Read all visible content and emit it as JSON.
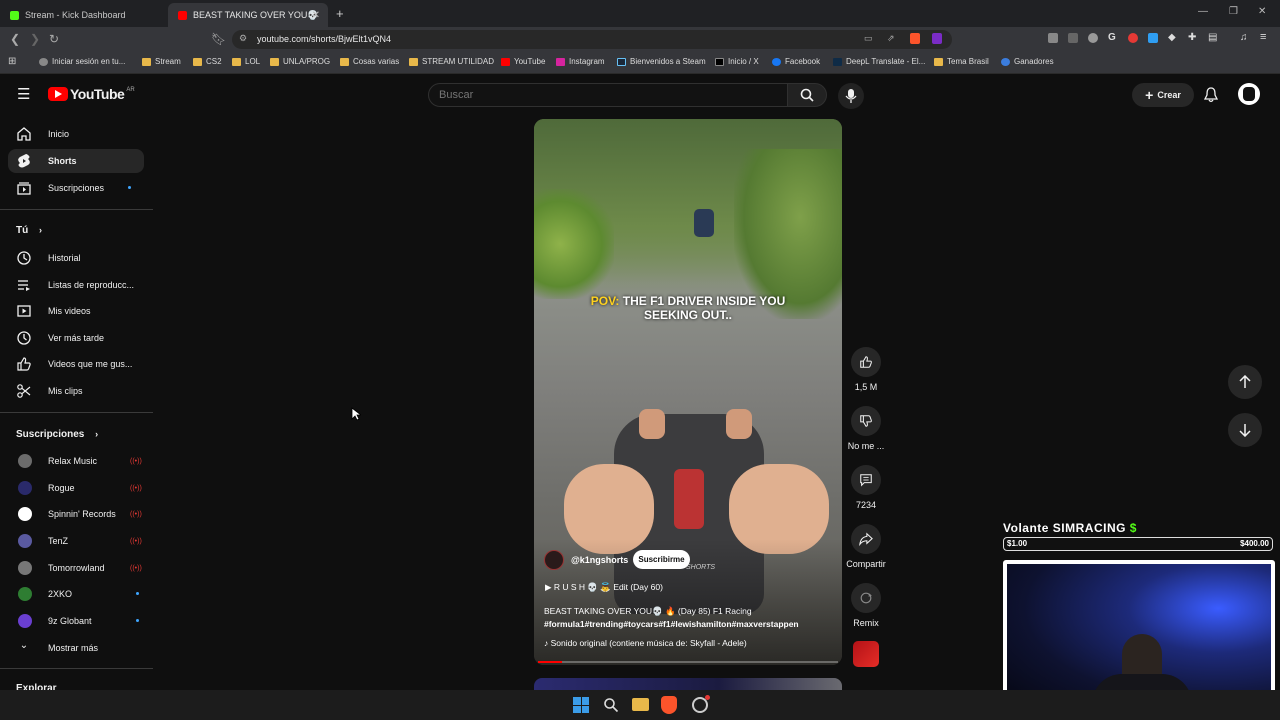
{
  "browser": {
    "tabs": [
      {
        "label": "Stream - Kick Dashboard",
        "active": false
      },
      {
        "label": "BEAST TAKING OVER YOU💀",
        "active": true
      }
    ],
    "new_tab": "+",
    "url": "youtube.com/shorts/BjwElt1vQN4",
    "bookmarks": [
      {
        "label": "Iniciar sesión en tu...",
        "icon": "globe-icon"
      },
      {
        "label": "Stream",
        "icon": "folder-icon"
      },
      {
        "label": "CS2",
        "icon": "folder-icon"
      },
      {
        "label": "LOL",
        "icon": "folder-icon"
      },
      {
        "label": "UNLA/PROG",
        "icon": "folder-icon"
      },
      {
        "label": "Cosas varias",
        "icon": "folder-icon"
      },
      {
        "label": "STREAM UTILIDAD",
        "icon": "folder-icon"
      },
      {
        "label": "YouTube",
        "icon": "youtube-icon"
      },
      {
        "label": "Instagram",
        "icon": "instagram-icon"
      },
      {
        "label": "Bienvenidos a Steam",
        "icon": "steam-icon"
      },
      {
        "label": "Inicio / X",
        "icon": "x-icon"
      },
      {
        "label": "Facebook",
        "icon": "facebook-icon"
      },
      {
        "label": "DeepL Translate - El...",
        "icon": "deepl-icon"
      },
      {
        "label": "Tema Brasil",
        "icon": "folder-icon"
      },
      {
        "label": "Ganadores",
        "icon": "globe-icon"
      }
    ]
  },
  "youtube": {
    "logo": "YouTube",
    "region": "AR",
    "search_placeholder": "Buscar",
    "create_label": "Crear",
    "sidebar": {
      "main": [
        {
          "label": "Inicio",
          "icon": "home-icon"
        },
        {
          "label": "Shorts",
          "icon": "shorts-icon",
          "active": true
        },
        {
          "label": "Suscripciones",
          "icon": "subscriptions-icon"
        }
      ],
      "you_header": "Tú",
      "you": [
        {
          "label": "Historial",
          "icon": "history-icon"
        },
        {
          "label": "Listas de reproducc...",
          "icon": "playlist-icon"
        },
        {
          "label": "Mis videos",
          "icon": "my-videos-icon"
        },
        {
          "label": "Ver más tarde",
          "icon": "clock-icon"
        },
        {
          "label": "Videos que me gus...",
          "icon": "thumb-up-icon"
        },
        {
          "label": "Mis clips",
          "icon": "scissors-icon"
        }
      ],
      "subs_header": "Suscripciones",
      "subs": [
        {
          "label": "Relax Music",
          "status": "live",
          "color": "#6b6b6b"
        },
        {
          "label": "Rogue",
          "status": "live",
          "color": "#2a2a6a"
        },
        {
          "label": "Spinnin' Records",
          "status": "live",
          "color": "#ffffff"
        },
        {
          "label": "TenZ",
          "status": "live",
          "color": "#5a5aa0"
        },
        {
          "label": "Tomorrowland",
          "status": "live",
          "color": "#777777"
        },
        {
          "label": "2XKO",
          "status": "new",
          "color": "#2e7d32"
        },
        {
          "label": "9z Globant",
          "status": "new",
          "color": "#6a3fd0"
        }
      ],
      "show_more": "Mostrar más",
      "explore_header": "Explorar"
    },
    "short": {
      "overlay_highlight": "POV:",
      "overlay_text_1": "THE F1 DRIVER INSIDE YOU",
      "overlay_text_2": "SEEKING OUT..",
      "channel": "@k1ngshorts",
      "subscribe": "Suscribirme",
      "playlist": "R U S H 💀 👼 Edit (Day 60)",
      "title": "BEAST TAKING OVER YOU💀 🔥 (Day 85) F1 Racing",
      "hashtags": "#formula1#trending#toycars#f1#lewishamilton#maxverstappen",
      "sound": "Sonido original (contiene música de: Skyfall - Adele)",
      "watermark": "SHORTS"
    },
    "actions": {
      "likes": "1,5 M",
      "dislike": "No me ...",
      "comments": "7234",
      "share": "Compartir",
      "remix": "Remix"
    }
  },
  "stream_overlay": {
    "title": "Volante SIMRACING",
    "goal_start": "$1.00",
    "goal_end": "$400.00"
  }
}
